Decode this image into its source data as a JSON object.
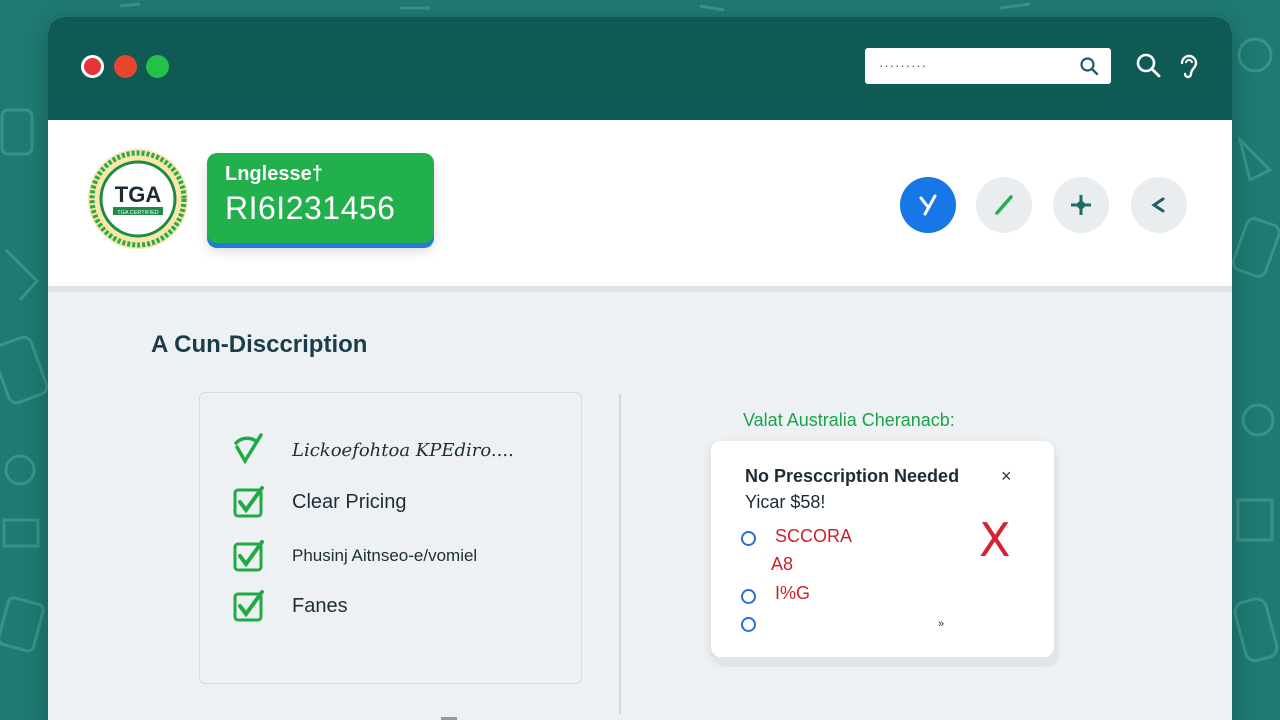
{
  "colors": {
    "brand_green": "#21b04b",
    "title_bar": "#0f5a55",
    "accent_blue": "#1877e6",
    "alert_red": "#d8202f"
  },
  "titlebar": {
    "search_placeholder": "·········",
    "icons": [
      "search-icon",
      "ear-icon"
    ]
  },
  "header": {
    "seal_text": "TGA",
    "seal_subtext": "TGA CERTIFIED",
    "registration_line1": "Lnglesse†",
    "registration_number": "RI6I231456",
    "action_buttons": [
      "checkmark-icon",
      "edit-icon",
      "add-icon",
      "back-icon"
    ]
  },
  "main": {
    "section_title": "A  Cun-Disccription",
    "features": [
      {
        "label": "Lickoefohtoa KPEdiro....",
        "icon": "check-icon"
      },
      {
        "label": "Clear Pricing",
        "icon": "check-icon"
      },
      {
        "label": "Phusinj Aitnseo-e/vomiel",
        "icon": "check-icon"
      },
      {
        "label": "Fanes",
        "icon": "check-icon"
      }
    ],
    "compare_title": "Valat Australia Cheranacb:",
    "popup": {
      "title": "No Presccription Needed",
      "close": "×",
      "price": "Yicar $58!",
      "options": [
        "SCCORA",
        "A8",
        "I%G",
        ""
      ],
      "rejected_mark": "X",
      "tiny_mark": "»"
    }
  }
}
